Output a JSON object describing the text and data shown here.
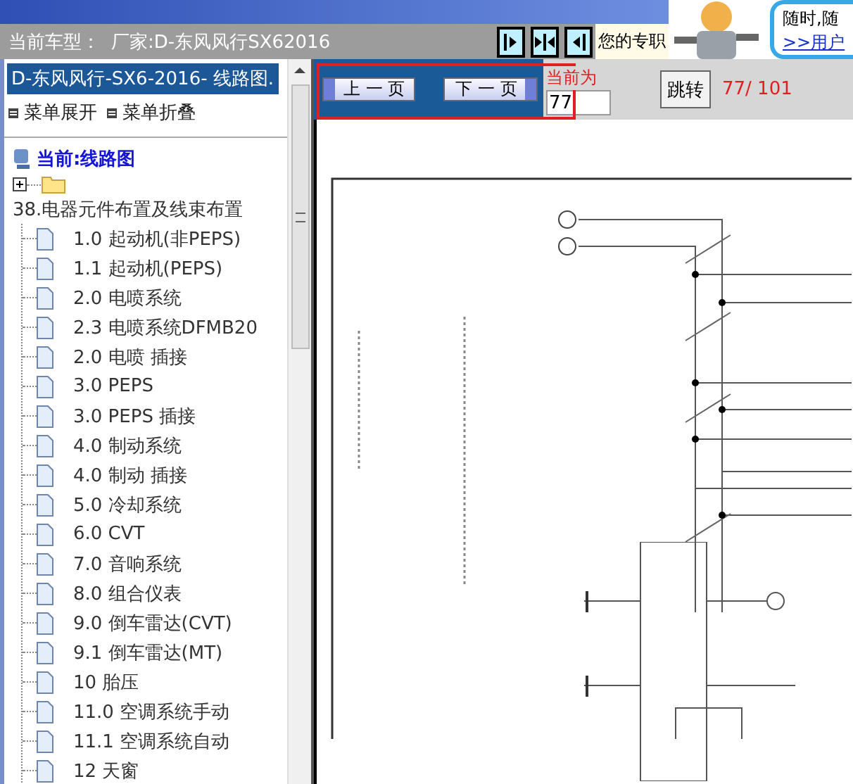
{
  "header": {
    "vehicle_label": "当前车型：",
    "vehicle": "厂家:D-东风风行SX62016",
    "promo_text": "您的专职",
    "bubble_text": "随时,随",
    "bubble_link": ">>用户"
  },
  "sidebar": {
    "title": "D-东风风行-SX6-2016- 线路图.",
    "menu_expand": "菜单展开",
    "menu_collapse": "菜单折叠",
    "current": "当前:线路图",
    "folder": {
      "expanded": false
    },
    "section": {
      "label": "38.电器元件布置及线束布置",
      "children": [
        {
          "label": "1.0 起动机(非PEPS)"
        },
        {
          "label": "1.1 起动机(PEPS)"
        },
        {
          "label": "2.0 电喷系统"
        },
        {
          "label": "2.3 电喷系统DFMB20"
        },
        {
          "label": "2.0 电喷 插接"
        },
        {
          "label": "3.0 PEPS"
        },
        {
          "label": "3.0 PEPS 插接"
        },
        {
          "label": "4.0 制动系统"
        },
        {
          "label": "4.0 制动 插接"
        },
        {
          "label": "5.0 冷却系统"
        },
        {
          "label": "6.0 CVT"
        },
        {
          "label": "7.0 音响系统"
        },
        {
          "label": "8.0 组合仪表"
        },
        {
          "label": "9.0 倒车雷达(CVT)"
        },
        {
          "label": "9.1 倒车雷达(MT)"
        },
        {
          "label": "10 胎压"
        },
        {
          "label": "11.0 空调系统手动"
        },
        {
          "label": "11.1 空调系统自动"
        },
        {
          "label": "12 天窗"
        }
      ]
    }
  },
  "pager": {
    "prev": "上 一 页",
    "next": "下 一 页",
    "current_label": "当前为",
    "page_value": "77",
    "jump": "跳转",
    "page_count": "77/ 101"
  }
}
